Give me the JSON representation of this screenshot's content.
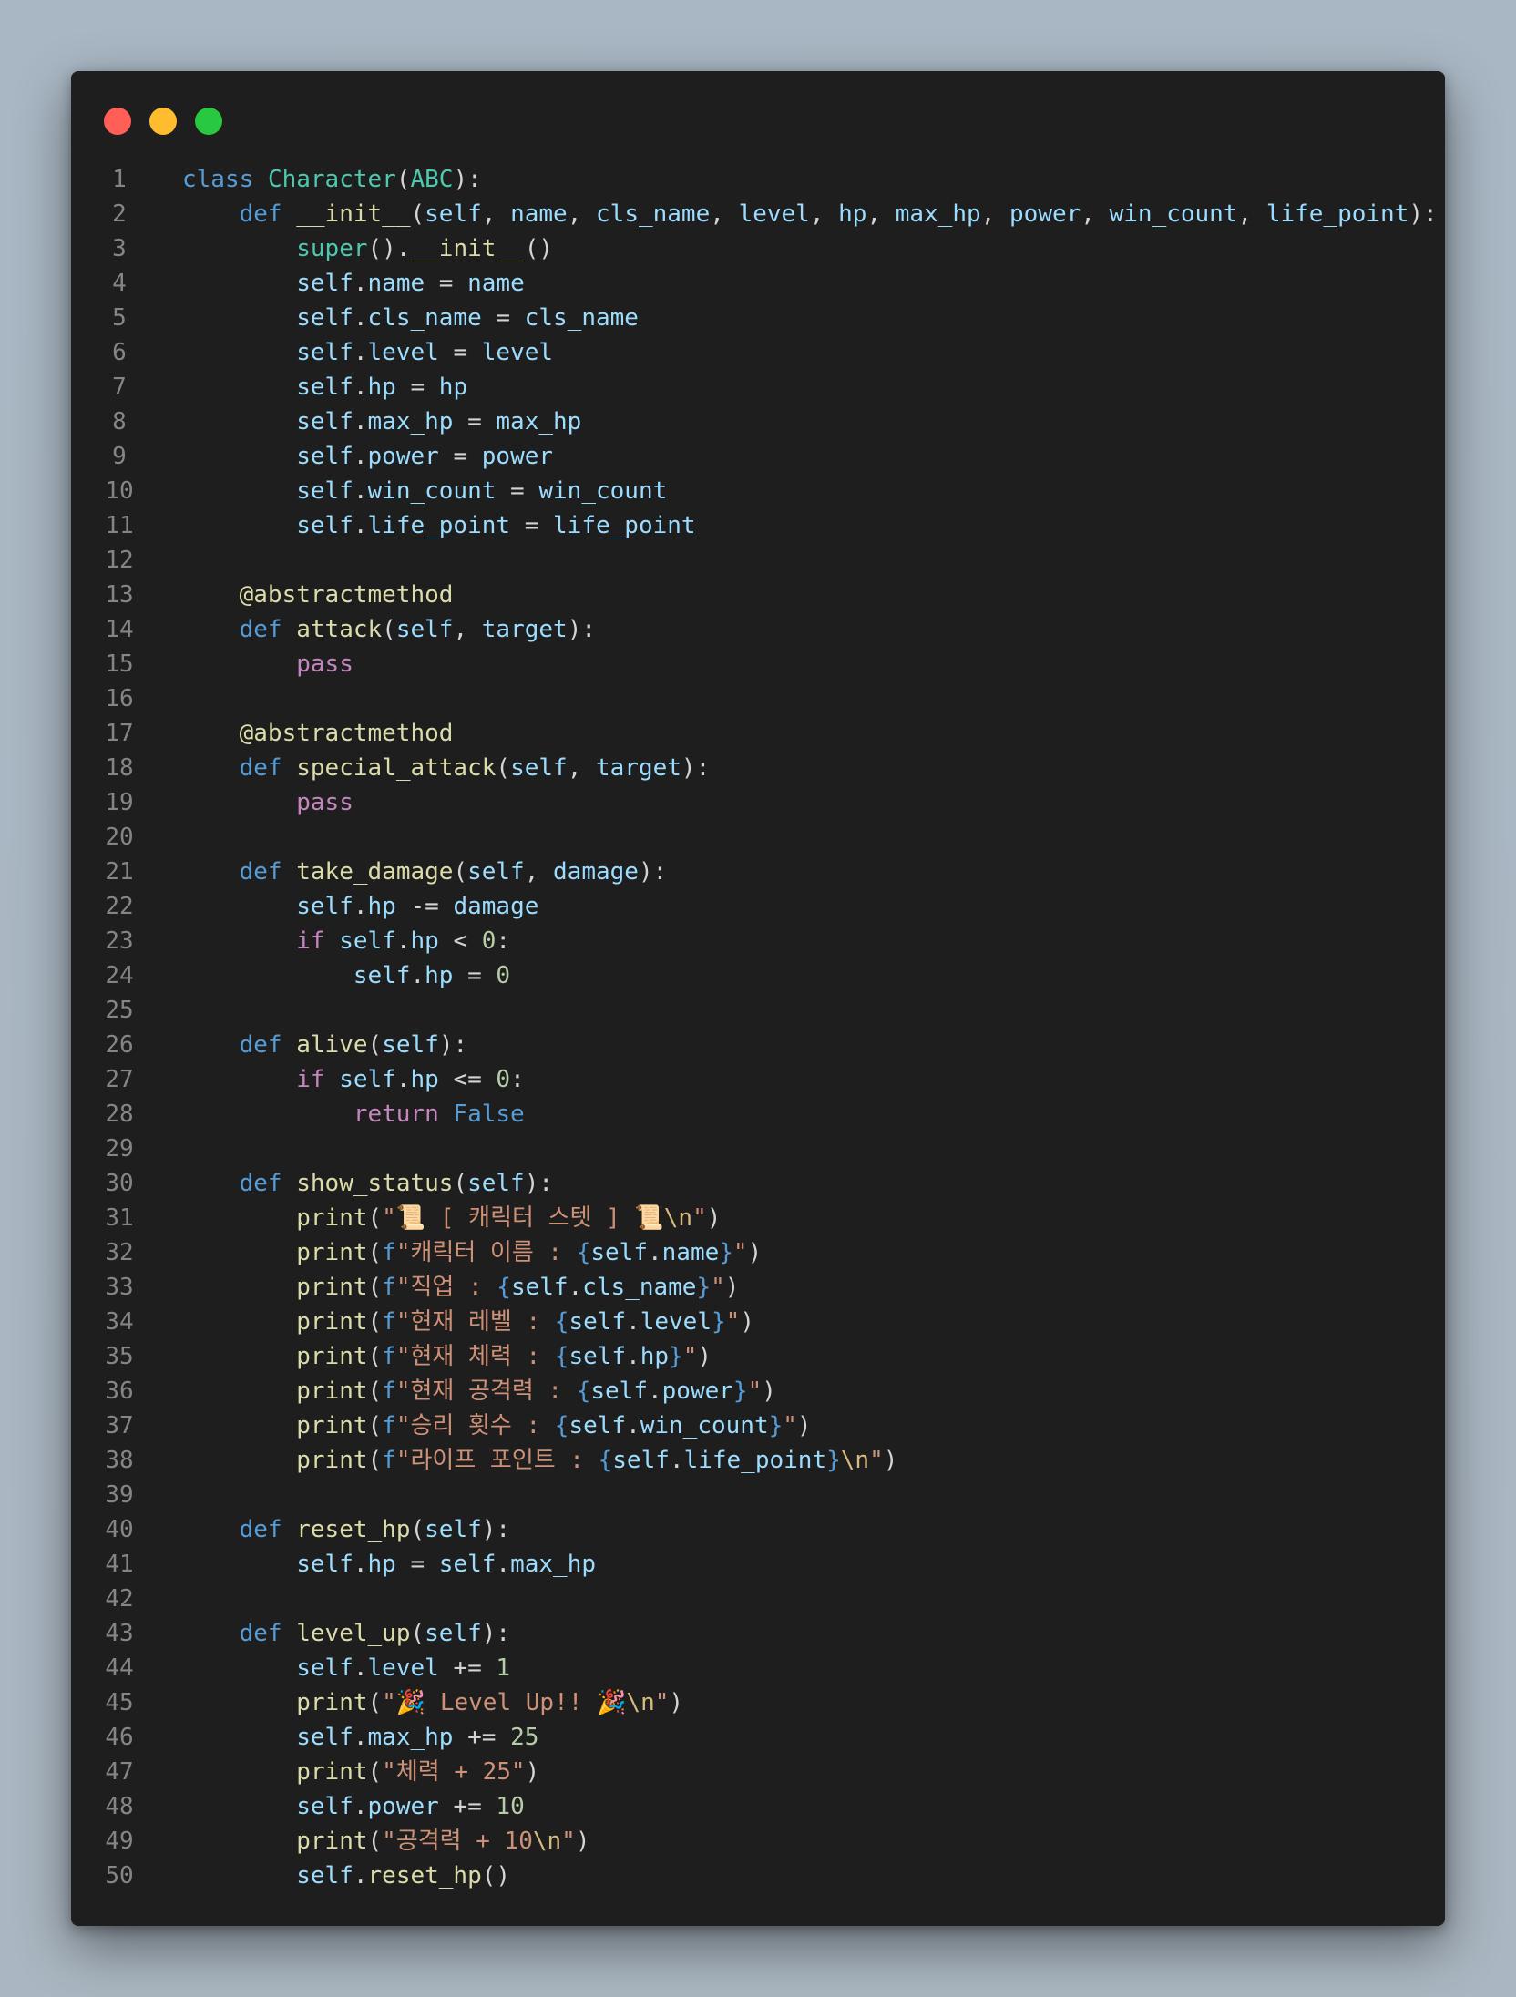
{
  "window": {
    "traffic_lights": [
      {
        "name": "close-button",
        "color": "#ff5f57"
      },
      {
        "name": "minimize-button",
        "color": "#febc2e"
      },
      {
        "name": "maximize-button",
        "color": "#28c840"
      }
    ]
  },
  "editor": {
    "lines": [
      [
        [
          "kw",
          "class"
        ],
        [
          "op",
          " "
        ],
        [
          "cls",
          "Character"
        ],
        [
          "op",
          "("
        ],
        [
          "cls",
          "ABC"
        ],
        [
          "op",
          "):"
        ]
      ],
      [
        [
          "op",
          "    "
        ],
        [
          "kw",
          "def"
        ],
        [
          "op",
          " "
        ],
        [
          "fn",
          "__init__"
        ],
        [
          "op",
          "("
        ],
        [
          "var",
          "self"
        ],
        [
          "op",
          ", "
        ],
        [
          "var",
          "name"
        ],
        [
          "op",
          ", "
        ],
        [
          "var",
          "cls_name"
        ],
        [
          "op",
          ", "
        ],
        [
          "var",
          "level"
        ],
        [
          "op",
          ", "
        ],
        [
          "var",
          "hp"
        ],
        [
          "op",
          ", "
        ],
        [
          "var",
          "max_hp"
        ],
        [
          "op",
          ", "
        ],
        [
          "var",
          "power"
        ],
        [
          "op",
          ", "
        ],
        [
          "var",
          "win_count"
        ],
        [
          "op",
          ", "
        ],
        [
          "var",
          "life_point"
        ],
        [
          "op",
          "):"
        ]
      ],
      [
        [
          "op",
          "        "
        ],
        [
          "cls",
          "super"
        ],
        [
          "op",
          "()."
        ],
        [
          "fn",
          "__init__"
        ],
        [
          "op",
          "()"
        ]
      ],
      [
        [
          "op",
          "        "
        ],
        [
          "var",
          "self"
        ],
        [
          "op",
          "."
        ],
        [
          "var",
          "name"
        ],
        [
          "op",
          " = "
        ],
        [
          "var",
          "name"
        ]
      ],
      [
        [
          "op",
          "        "
        ],
        [
          "var",
          "self"
        ],
        [
          "op",
          "."
        ],
        [
          "var",
          "cls_name"
        ],
        [
          "op",
          " = "
        ],
        [
          "var",
          "cls_name"
        ]
      ],
      [
        [
          "op",
          "        "
        ],
        [
          "var",
          "self"
        ],
        [
          "op",
          "."
        ],
        [
          "var",
          "level"
        ],
        [
          "op",
          " = "
        ],
        [
          "var",
          "level"
        ]
      ],
      [
        [
          "op",
          "        "
        ],
        [
          "var",
          "self"
        ],
        [
          "op",
          "."
        ],
        [
          "var",
          "hp"
        ],
        [
          "op",
          " = "
        ],
        [
          "var",
          "hp"
        ]
      ],
      [
        [
          "op",
          "        "
        ],
        [
          "var",
          "self"
        ],
        [
          "op",
          "."
        ],
        [
          "var",
          "max_hp"
        ],
        [
          "op",
          " = "
        ],
        [
          "var",
          "max_hp"
        ]
      ],
      [
        [
          "op",
          "        "
        ],
        [
          "var",
          "self"
        ],
        [
          "op",
          "."
        ],
        [
          "var",
          "power"
        ],
        [
          "op",
          " = "
        ],
        [
          "var",
          "power"
        ]
      ],
      [
        [
          "op",
          "        "
        ],
        [
          "var",
          "self"
        ],
        [
          "op",
          "."
        ],
        [
          "var",
          "win_count"
        ],
        [
          "op",
          " = "
        ],
        [
          "var",
          "win_count"
        ]
      ],
      [
        [
          "op",
          "        "
        ],
        [
          "var",
          "self"
        ],
        [
          "op",
          "."
        ],
        [
          "var",
          "life_point"
        ],
        [
          "op",
          " = "
        ],
        [
          "var",
          "life_point"
        ]
      ],
      [],
      [
        [
          "op",
          "    "
        ],
        [
          "dec",
          "@abstractmethod"
        ]
      ],
      [
        [
          "op",
          "    "
        ],
        [
          "kw",
          "def"
        ],
        [
          "op",
          " "
        ],
        [
          "fn",
          "attack"
        ],
        [
          "op",
          "("
        ],
        [
          "var",
          "self"
        ],
        [
          "op",
          ", "
        ],
        [
          "var",
          "target"
        ],
        [
          "op",
          "):"
        ]
      ],
      [
        [
          "op",
          "        "
        ],
        [
          "ctl",
          "pass"
        ]
      ],
      [],
      [
        [
          "op",
          "    "
        ],
        [
          "dec",
          "@abstractmethod"
        ]
      ],
      [
        [
          "op",
          "    "
        ],
        [
          "kw",
          "def"
        ],
        [
          "op",
          " "
        ],
        [
          "fn",
          "special_attack"
        ],
        [
          "op",
          "("
        ],
        [
          "var",
          "self"
        ],
        [
          "op",
          ", "
        ],
        [
          "var",
          "target"
        ],
        [
          "op",
          "):"
        ]
      ],
      [
        [
          "op",
          "        "
        ],
        [
          "ctl",
          "pass"
        ]
      ],
      [],
      [
        [
          "op",
          "    "
        ],
        [
          "kw",
          "def"
        ],
        [
          "op",
          " "
        ],
        [
          "fn",
          "take_damage"
        ],
        [
          "op",
          "("
        ],
        [
          "var",
          "self"
        ],
        [
          "op",
          ", "
        ],
        [
          "var",
          "damage"
        ],
        [
          "op",
          "):"
        ]
      ],
      [
        [
          "op",
          "        "
        ],
        [
          "var",
          "self"
        ],
        [
          "op",
          "."
        ],
        [
          "var",
          "hp"
        ],
        [
          "op",
          " -= "
        ],
        [
          "var",
          "damage"
        ]
      ],
      [
        [
          "op",
          "        "
        ],
        [
          "ctl",
          "if"
        ],
        [
          "op",
          " "
        ],
        [
          "var",
          "self"
        ],
        [
          "op",
          "."
        ],
        [
          "var",
          "hp"
        ],
        [
          "op",
          " < "
        ],
        [
          "num",
          "0"
        ],
        [
          "op",
          ":"
        ]
      ],
      [
        [
          "op",
          "            "
        ],
        [
          "var",
          "self"
        ],
        [
          "op",
          "."
        ],
        [
          "var",
          "hp"
        ],
        [
          "op",
          " = "
        ],
        [
          "num",
          "0"
        ]
      ],
      [],
      [
        [
          "op",
          "    "
        ],
        [
          "kw",
          "def"
        ],
        [
          "op",
          " "
        ],
        [
          "fn",
          "alive"
        ],
        [
          "op",
          "("
        ],
        [
          "var",
          "self"
        ],
        [
          "op",
          "):"
        ]
      ],
      [
        [
          "op",
          "        "
        ],
        [
          "ctl",
          "if"
        ],
        [
          "op",
          " "
        ],
        [
          "var",
          "self"
        ],
        [
          "op",
          "."
        ],
        [
          "var",
          "hp"
        ],
        [
          "op",
          " <= "
        ],
        [
          "num",
          "0"
        ],
        [
          "op",
          ":"
        ]
      ],
      [
        [
          "op",
          "            "
        ],
        [
          "ctl",
          "return"
        ],
        [
          "op",
          " "
        ],
        [
          "kw",
          "False"
        ]
      ],
      [],
      [
        [
          "op",
          "    "
        ],
        [
          "kw",
          "def"
        ],
        [
          "op",
          " "
        ],
        [
          "fn",
          "show_status"
        ],
        [
          "op",
          "("
        ],
        [
          "var",
          "self"
        ],
        [
          "op",
          "):"
        ]
      ],
      [
        [
          "op",
          "        "
        ],
        [
          "fn",
          "print"
        ],
        [
          "op",
          "("
        ],
        [
          "str",
          "\"📜 [ 캐릭터 스텟 ] 📜"
        ],
        [
          "esc",
          "\\n"
        ],
        [
          "str",
          "\""
        ],
        [
          "op",
          ")"
        ]
      ],
      [
        [
          "op",
          "        "
        ],
        [
          "fn",
          "print"
        ],
        [
          "op",
          "("
        ],
        [
          "kw",
          "f"
        ],
        [
          "str",
          "\"캐릭터 이름 : "
        ],
        [
          "brace",
          "{"
        ],
        [
          "var",
          "self"
        ],
        [
          "op",
          "."
        ],
        [
          "var",
          "name"
        ],
        [
          "brace",
          "}"
        ],
        [
          "str",
          "\""
        ],
        [
          "op",
          ")"
        ]
      ],
      [
        [
          "op",
          "        "
        ],
        [
          "fn",
          "print"
        ],
        [
          "op",
          "("
        ],
        [
          "kw",
          "f"
        ],
        [
          "str",
          "\"직업 : "
        ],
        [
          "brace",
          "{"
        ],
        [
          "var",
          "self"
        ],
        [
          "op",
          "."
        ],
        [
          "var",
          "cls_name"
        ],
        [
          "brace",
          "}"
        ],
        [
          "str",
          "\""
        ],
        [
          "op",
          ")"
        ]
      ],
      [
        [
          "op",
          "        "
        ],
        [
          "fn",
          "print"
        ],
        [
          "op",
          "("
        ],
        [
          "kw",
          "f"
        ],
        [
          "str",
          "\"현재 레벨 : "
        ],
        [
          "brace",
          "{"
        ],
        [
          "var",
          "self"
        ],
        [
          "op",
          "."
        ],
        [
          "var",
          "level"
        ],
        [
          "brace",
          "}"
        ],
        [
          "str",
          "\""
        ],
        [
          "op",
          ")"
        ]
      ],
      [
        [
          "op",
          "        "
        ],
        [
          "fn",
          "print"
        ],
        [
          "op",
          "("
        ],
        [
          "kw",
          "f"
        ],
        [
          "str",
          "\"현재 체력 : "
        ],
        [
          "brace",
          "{"
        ],
        [
          "var",
          "self"
        ],
        [
          "op",
          "."
        ],
        [
          "var",
          "hp"
        ],
        [
          "brace",
          "}"
        ],
        [
          "str",
          "\""
        ],
        [
          "op",
          ")"
        ]
      ],
      [
        [
          "op",
          "        "
        ],
        [
          "fn",
          "print"
        ],
        [
          "op",
          "("
        ],
        [
          "kw",
          "f"
        ],
        [
          "str",
          "\"현재 공격력 : "
        ],
        [
          "brace",
          "{"
        ],
        [
          "var",
          "self"
        ],
        [
          "op",
          "."
        ],
        [
          "var",
          "power"
        ],
        [
          "brace",
          "}"
        ],
        [
          "str",
          "\""
        ],
        [
          "op",
          ")"
        ]
      ],
      [
        [
          "op",
          "        "
        ],
        [
          "fn",
          "print"
        ],
        [
          "op",
          "("
        ],
        [
          "kw",
          "f"
        ],
        [
          "str",
          "\"승리 횟수 : "
        ],
        [
          "brace",
          "{"
        ],
        [
          "var",
          "self"
        ],
        [
          "op",
          "."
        ],
        [
          "var",
          "win_count"
        ],
        [
          "brace",
          "}"
        ],
        [
          "str",
          "\""
        ],
        [
          "op",
          ")"
        ]
      ],
      [
        [
          "op",
          "        "
        ],
        [
          "fn",
          "print"
        ],
        [
          "op",
          "("
        ],
        [
          "kw",
          "f"
        ],
        [
          "str",
          "\"라이프 포인트 : "
        ],
        [
          "brace",
          "{"
        ],
        [
          "var",
          "self"
        ],
        [
          "op",
          "."
        ],
        [
          "var",
          "life_point"
        ],
        [
          "brace",
          "}"
        ],
        [
          "esc",
          "\\n"
        ],
        [
          "str",
          "\""
        ],
        [
          "op",
          ")"
        ]
      ],
      [],
      [
        [
          "op",
          "    "
        ],
        [
          "kw",
          "def"
        ],
        [
          "op",
          " "
        ],
        [
          "fn",
          "reset_hp"
        ],
        [
          "op",
          "("
        ],
        [
          "var",
          "self"
        ],
        [
          "op",
          "):"
        ]
      ],
      [
        [
          "op",
          "        "
        ],
        [
          "var",
          "self"
        ],
        [
          "op",
          "."
        ],
        [
          "var",
          "hp"
        ],
        [
          "op",
          " = "
        ],
        [
          "var",
          "self"
        ],
        [
          "op",
          "."
        ],
        [
          "var",
          "max_hp"
        ]
      ],
      [],
      [
        [
          "op",
          "    "
        ],
        [
          "kw",
          "def"
        ],
        [
          "op",
          " "
        ],
        [
          "fn",
          "level_up"
        ],
        [
          "op",
          "("
        ],
        [
          "var",
          "self"
        ],
        [
          "op",
          "):"
        ]
      ],
      [
        [
          "op",
          "        "
        ],
        [
          "var",
          "self"
        ],
        [
          "op",
          "."
        ],
        [
          "var",
          "level"
        ],
        [
          "op",
          " += "
        ],
        [
          "num",
          "1"
        ]
      ],
      [
        [
          "op",
          "        "
        ],
        [
          "fn",
          "print"
        ],
        [
          "op",
          "("
        ],
        [
          "str",
          "\"🎉 Level Up!! 🎉"
        ],
        [
          "esc",
          "\\n"
        ],
        [
          "str",
          "\""
        ],
        [
          "op",
          ")"
        ]
      ],
      [
        [
          "op",
          "        "
        ],
        [
          "var",
          "self"
        ],
        [
          "op",
          "."
        ],
        [
          "var",
          "max_hp"
        ],
        [
          "op",
          " += "
        ],
        [
          "num",
          "25"
        ]
      ],
      [
        [
          "op",
          "        "
        ],
        [
          "fn",
          "print"
        ],
        [
          "op",
          "("
        ],
        [
          "str",
          "\"체력 + 25\""
        ],
        [
          "op",
          ")"
        ]
      ],
      [
        [
          "op",
          "        "
        ],
        [
          "var",
          "self"
        ],
        [
          "op",
          "."
        ],
        [
          "var",
          "power"
        ],
        [
          "op",
          " += "
        ],
        [
          "num",
          "10"
        ]
      ],
      [
        [
          "op",
          "        "
        ],
        [
          "fn",
          "print"
        ],
        [
          "op",
          "("
        ],
        [
          "str",
          "\"공격력 + 10"
        ],
        [
          "esc",
          "\\n"
        ],
        [
          "str",
          "\""
        ],
        [
          "op",
          ")"
        ]
      ],
      [
        [
          "op",
          "        "
        ],
        [
          "var",
          "self"
        ],
        [
          "op",
          "."
        ],
        [
          "fn",
          "reset_hp"
        ],
        [
          "op",
          "()"
        ]
      ]
    ]
  }
}
